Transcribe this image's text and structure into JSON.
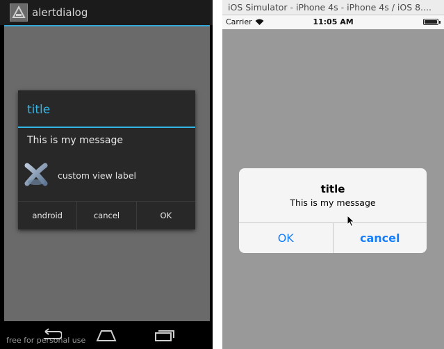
{
  "android": {
    "app_title": "alertdialog",
    "dialog": {
      "title": "title",
      "message": "This is my message",
      "custom_view_label": "custom view label",
      "buttons": [
        "android",
        "cancel",
        "OK"
      ]
    },
    "watermark": "free for personal use",
    "icons": {
      "app": "app-logo-icon",
      "custom_view": "xamarin-logo-icon",
      "nav": [
        "back-icon",
        "home-icon",
        "recent-apps-icon"
      ]
    },
    "colors": {
      "accent": "#33b5e5",
      "dialog_bg": "#282828",
      "content_bg": "#6a6a6a"
    }
  },
  "ios": {
    "window_title": "iOS Simulator - iPhone 4s - iPhone 4s / iOS 8....",
    "status": {
      "carrier": "Carrier",
      "time": "11:05 AM"
    },
    "alert": {
      "title": "title",
      "message": "This is my message",
      "buttons": [
        "OK",
        "cancel"
      ]
    },
    "icons": {
      "wifi": "wifi-icon",
      "battery": "battery-icon",
      "cursor": "mouse-cursor-icon"
    },
    "colors": {
      "tint": "#157efb",
      "background": "#999999",
      "alert_bg": "#f5f5f5"
    }
  }
}
